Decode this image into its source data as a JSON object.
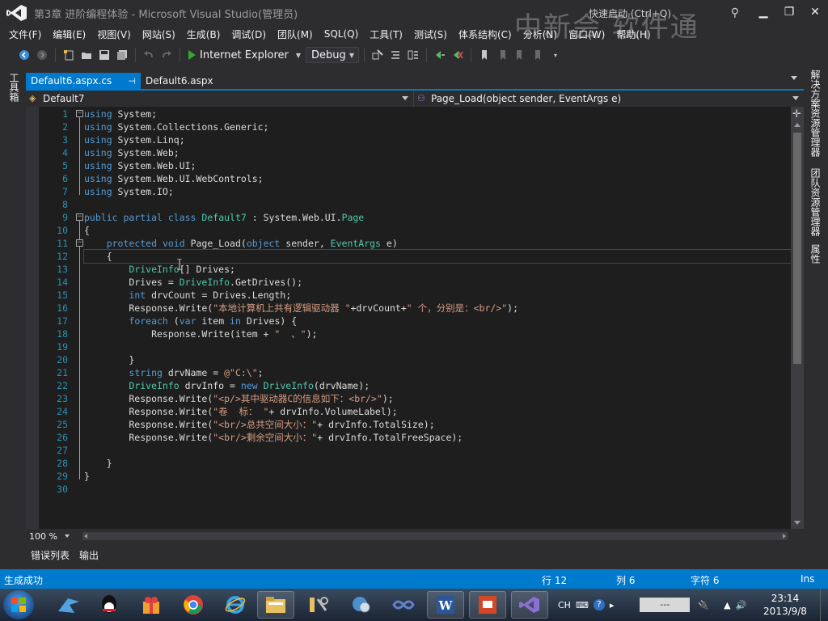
{
  "window": {
    "title": "第3章  进阶编程体验 - Microsoft Visual Studio(管理员)",
    "quick_launch": "快速启动 (Ctrl+Q)",
    "watermark": "中新会 软件通",
    "minimize": "▁",
    "restore": "❐",
    "close": "✕"
  },
  "menu": [
    "文件(F)",
    "编辑(E)",
    "视图(V)",
    "网站(S)",
    "生成(B)",
    "调试(D)",
    "团队(M)",
    "SQL(Q)",
    "工具(T)",
    "测试(S)",
    "体系结构(C)",
    "分析(N)",
    "窗口(W)",
    "帮助(H)"
  ],
  "toolbar": {
    "run_target": "Internet Explorer",
    "configuration": "Debug"
  },
  "left_panel": {
    "toolbox": "工具箱"
  },
  "right_panels": [
    "解决方案资源管理器",
    "团队资源管理器",
    "属性"
  ],
  "tabs": [
    {
      "label": "Default6.aspx.cs",
      "active": true,
      "pin": "⊣"
    },
    {
      "label": "Default6.aspx",
      "active": false
    }
  ],
  "navbar": {
    "class": "Default7",
    "member": "Page_Load(object sender, EventArgs e)"
  },
  "editor": {
    "current_line": 12,
    "lines": [
      [
        [
          "kw",
          "using"
        ],
        [
          "t",
          " System;"
        ]
      ],
      [
        [
          "kw",
          "using"
        ],
        [
          "t",
          " System.Collections.Generic;"
        ]
      ],
      [
        [
          "kw",
          "using"
        ],
        [
          "t",
          " System.Linq;"
        ]
      ],
      [
        [
          "kw",
          "using"
        ],
        [
          "t",
          " System.Web;"
        ]
      ],
      [
        [
          "kw",
          "using"
        ],
        [
          "t",
          " System.Web.UI;"
        ]
      ],
      [
        [
          "kw",
          "using"
        ],
        [
          "t",
          " System.Web.UI.WebControls;"
        ]
      ],
      [
        [
          "kw",
          "using"
        ],
        [
          "t",
          " System.IO;"
        ]
      ],
      [],
      [
        [
          "kw",
          "public partial class"
        ],
        [
          "t",
          " "
        ],
        [
          "ty",
          "Default7"
        ],
        [
          "t",
          " : System.Web.UI."
        ],
        [
          "ty",
          "Page"
        ]
      ],
      [
        [
          "t",
          "{"
        ]
      ],
      [
        [
          "t",
          "    "
        ],
        [
          "kw",
          "protected void"
        ],
        [
          "t",
          " Page_Load("
        ],
        [
          "kw",
          "object"
        ],
        [
          "t",
          " sender, "
        ],
        [
          "ty",
          "EventArgs"
        ],
        [
          "t",
          " e)"
        ]
      ],
      [
        [
          "t",
          "    {"
        ]
      ],
      [
        [
          "t",
          "        "
        ],
        [
          "ty",
          "DriveInfo"
        ],
        [
          "t",
          "[] Drives;"
        ]
      ],
      [
        [
          "t",
          "        Drives = "
        ],
        [
          "ty",
          "DriveInfo"
        ],
        [
          "t",
          ".GetDrives();"
        ]
      ],
      [
        [
          "t",
          "        "
        ],
        [
          "kw",
          "int"
        ],
        [
          "t",
          " drvCount = Drives.Length;"
        ]
      ],
      [
        [
          "t",
          "        Response.Write("
        ],
        [
          "st",
          "\"本地计算机上共有逻辑驱动器 \""
        ],
        [
          "t",
          "+drvCount+"
        ],
        [
          "st",
          "\" 个，分别是：<br/>\""
        ],
        [
          "t",
          ");"
        ]
      ],
      [
        [
          "t",
          "        "
        ],
        [
          "kw",
          "foreach"
        ],
        [
          "t",
          " ("
        ],
        [
          "kw",
          "var"
        ],
        [
          "t",
          " item "
        ],
        [
          "kw",
          "in"
        ],
        [
          "t",
          " Drives) {"
        ]
      ],
      [
        [
          "t",
          "            Response.Write(item + "
        ],
        [
          "st",
          "\"  、\""
        ],
        [
          "t",
          ");"
        ]
      ],
      [],
      [
        [
          "t",
          "        }"
        ]
      ],
      [
        [
          "t",
          "        "
        ],
        [
          "kw",
          "string"
        ],
        [
          "t",
          " drvName = "
        ],
        [
          "st",
          "@\"C:\\\""
        ],
        [
          "t",
          ";"
        ]
      ],
      [
        [
          "t",
          "        "
        ],
        [
          "ty",
          "DriveInfo"
        ],
        [
          "t",
          " drvInfo = "
        ],
        [
          "kw",
          "new"
        ],
        [
          "t",
          " "
        ],
        [
          "ty",
          "DriveInfo"
        ],
        [
          "t",
          "(drvName);"
        ]
      ],
      [
        [
          "t",
          "        Response.Write("
        ],
        [
          "st",
          "\"<p/>其中驱动器C的信息如下：<br/>\""
        ],
        [
          "t",
          ");"
        ]
      ],
      [
        [
          "t",
          "        Response.Write("
        ],
        [
          "st",
          "\"卷  标： \""
        ],
        [
          "t",
          "+ drvInfo.VolumeLabel);"
        ]
      ],
      [
        [
          "t",
          "        Response.Write("
        ],
        [
          "st",
          "\"<br/>总共空间大小：\""
        ],
        [
          "t",
          "+ drvInfo.TotalSize);"
        ]
      ],
      [
        [
          "t",
          "        Response.Write("
        ],
        [
          "st",
          "\"<br/>剩余空间大小：\""
        ],
        [
          "t",
          "+ drvInfo.TotalFreeSpace);"
        ]
      ],
      [],
      [
        [
          "t",
          "    }"
        ]
      ],
      [
        [
          "t",
          "}"
        ]
      ],
      []
    ]
  },
  "zoom": "100 %",
  "bottom_tabs": [
    "错误列表",
    "输出"
  ],
  "status": {
    "message": "生成成功",
    "row": "行 12",
    "col": "列 6",
    "char": "字符 6",
    "mode": "Ins"
  },
  "taskbar": {
    "clock_time": "23:14",
    "clock_date": "2013/9/8",
    "ime": "CH",
    "tray_box": "---"
  },
  "colors": {
    "accent": "#007acc",
    "keyword": "#569cd6",
    "type": "#4ec9b0",
    "string": "#d69d85",
    "line_number": "#2b91af"
  }
}
